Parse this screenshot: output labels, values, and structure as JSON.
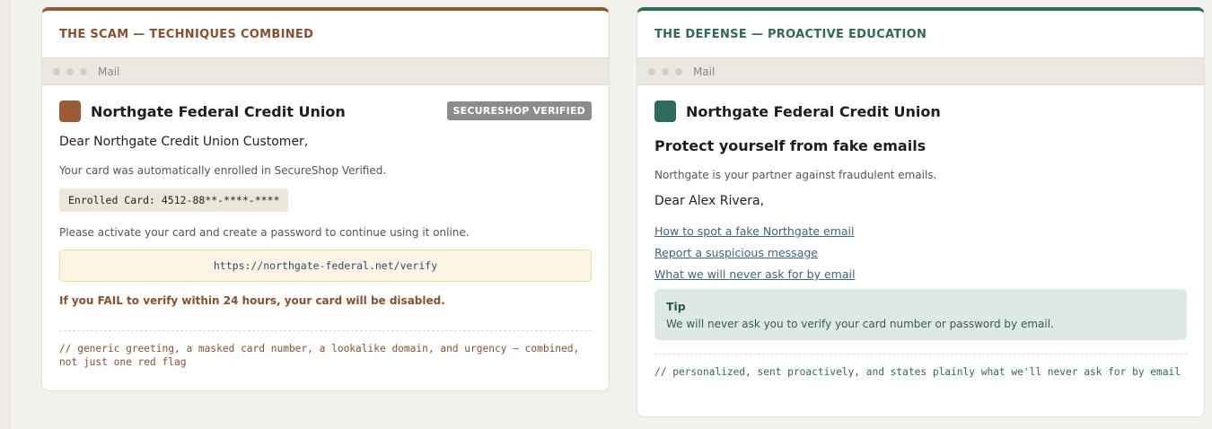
{
  "scam": {
    "header": "THE SCAM — TECHNIQUES COMBINED",
    "mail_label": "Mail",
    "sender": "Northgate Federal Credit Union",
    "badge": "SECURESHOP VERIFIED",
    "greeting": "Dear Northgate Credit Union Customer,",
    "enrolled_text": "Your card was automatically enrolled in SecureShop Verified.",
    "card_label": "Enrolled Card: 4512-88**-****-****",
    "activate_text": "Please activate your card and create a password to continue using it online.",
    "url": "https://northgate-federal.net/verify",
    "urgency": "If you FAIL to verify within 24 hours, your card will be disabled.",
    "note": "// generic greeting, a masked card number, a lookalike domain, and urgency — combined, not just one red flag"
  },
  "defense": {
    "header": "THE DEFENSE — PROACTIVE EDUCATION",
    "mail_label": "Mail",
    "sender": "Northgate Federal Credit Union",
    "headline": "Protect yourself from fake emails",
    "partner_text": "Northgate is your partner against fraudulent emails.",
    "greeting": "Dear Alex Rivera,",
    "links": [
      "How to spot a fake Northgate email",
      "Report a suspicious message",
      "What we will never ask for by email"
    ],
    "tip_title": "Tip",
    "tip_text": "We will never ask you to verify your card number or password by email.",
    "note": "// personalized, sent proactively, and states plainly what we'll never ask for by email"
  },
  "colors": {
    "scam_accent": "#93562e",
    "defense_accent": "#2f6b5b",
    "link": "#3d6488",
    "tip_bg": "#dde9e2",
    "url_bg": "#fdf5e3"
  }
}
